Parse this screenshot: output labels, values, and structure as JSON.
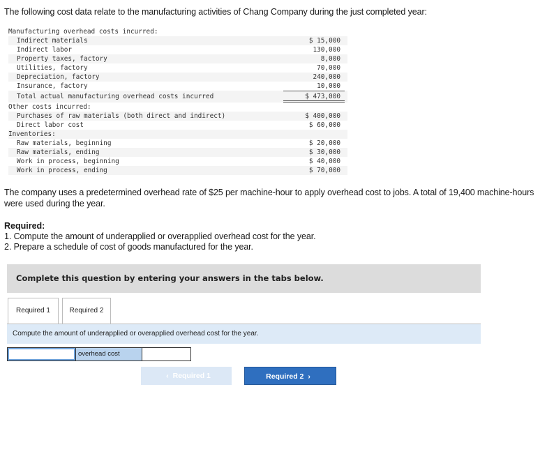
{
  "intro": "The following cost data relate to the manufacturing activities of Chang Company during the just completed year:",
  "table": {
    "mfg_header": "Manufacturing overhead costs incurred:",
    "mfg_items": [
      {
        "label": "Indirect materials",
        "value": "$ 15,000"
      },
      {
        "label": "Indirect labor",
        "value": "130,000"
      },
      {
        "label": "Property taxes, factory",
        "value": "8,000"
      },
      {
        "label": "Utilities, factory",
        "value": "70,000"
      },
      {
        "label": "Depreciation, factory",
        "value": "240,000"
      },
      {
        "label": "Insurance, factory",
        "value": "10,000"
      }
    ],
    "total": {
      "label": "Total actual manufacturing overhead costs incurred",
      "value": "$ 473,000"
    },
    "other_header": "Other costs incurred:",
    "other_items": [
      {
        "label": "Purchases of raw materials (both direct and indirect)",
        "value": "$ 400,000"
      },
      {
        "label": "Direct labor cost",
        "value": "$ 60,000"
      }
    ],
    "inv_header": "Inventories:",
    "inv_items": [
      {
        "label": "Raw materials, beginning",
        "value": "$ 20,000"
      },
      {
        "label": "Raw materials, ending",
        "value": "$ 30,000"
      },
      {
        "label": "Work in process, beginning",
        "value": "$ 40,000"
      },
      {
        "label": "Work in process, ending",
        "value": "$ 70,000"
      }
    ]
  },
  "paragraph": "The company uses a predetermined overhead rate of $25 per machine-hour to apply overhead cost to jobs. A total of 19,400 machine-hours were used during the year.",
  "required": {
    "heading": "Required:",
    "items": [
      "1. Compute the amount of underapplied or overapplied overhead cost for the year.",
      "2. Prepare a schedule of cost of goods manufactured for the year."
    ]
  },
  "banner": "Complete this question by entering your answers in the tabs below.",
  "tabs": [
    {
      "label": "Required 1",
      "active": true
    },
    {
      "label": "Required 2",
      "active": false
    }
  ],
  "instruction": "Compute the amount of underapplied or overapplied overhead cost for the year.",
  "answer_row": {
    "first_value": "",
    "label": "overhead cost",
    "third_value": ""
  },
  "nav": {
    "prev_label": "Required 1",
    "next_label": "Required 2",
    "prev_icon": "chevron-left-icon",
    "next_icon": "chevron-right-icon"
  },
  "colors": {
    "banner_bg": "#dcdcdc",
    "instruction_bg": "#ddeaf7",
    "label_cell_bg": "#b9d3ee",
    "next_button_bg": "#2f6fbf",
    "prev_button_bg": "#dce8f6"
  }
}
